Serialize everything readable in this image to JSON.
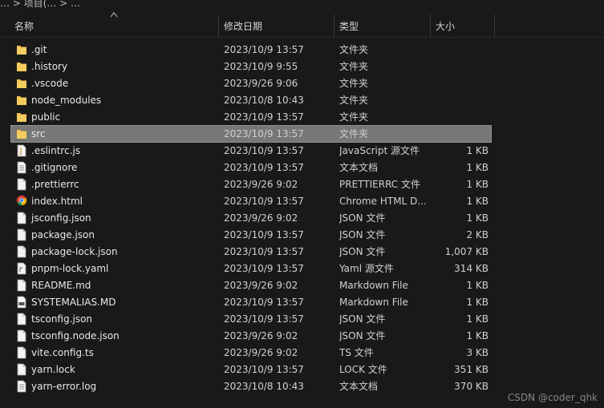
{
  "title_fragment": "… > 项目(… > …",
  "columns": {
    "name": "名称",
    "date": "修改日期",
    "type": "类型",
    "size": "大小"
  },
  "files": [
    {
      "name": ".git",
      "date": "2023/10/9 13:57",
      "type": "文件夹",
      "size": "",
      "icon": "folder-icon"
    },
    {
      "name": ".history",
      "date": "2023/10/9 9:55",
      "type": "文件夹",
      "size": "",
      "icon": "folder-icon"
    },
    {
      "name": ".vscode",
      "date": "2023/9/26 9:06",
      "type": "文件夹",
      "size": "",
      "icon": "folder-icon"
    },
    {
      "name": "node_modules",
      "date": "2023/10/8 10:43",
      "type": "文件夹",
      "size": "",
      "icon": "folder-icon"
    },
    {
      "name": "public",
      "date": "2023/10/9 13:57",
      "type": "文件夹",
      "size": "",
      "icon": "folder-icon"
    },
    {
      "name": "src",
      "date": "2023/10/9 13:57",
      "type": "文件夹",
      "size": "",
      "icon": "folder-icon",
      "selected": true
    },
    {
      "name": ".eslintrc.js",
      "date": "2023/10/9 13:57",
      "type": "JavaScript 源文件",
      "size": "1 KB",
      "icon": "js-file-icon"
    },
    {
      "name": ".gitignore",
      "date": "2023/10/9 13:57",
      "type": "文本文档",
      "size": "1 KB",
      "icon": "text-file-icon"
    },
    {
      "name": ".prettierrc",
      "date": "2023/9/26 9:02",
      "type": "PRETTIERRC 文件",
      "size": "1 KB",
      "icon": "file-icon"
    },
    {
      "name": "index.html",
      "date": "2023/10/9 13:57",
      "type": "Chrome HTML D...",
      "size": "1 KB",
      "icon": "chrome-icon"
    },
    {
      "name": "jsconfig.json",
      "date": "2023/9/26 9:02",
      "type": "JSON 文件",
      "size": "1 KB",
      "icon": "file-icon"
    },
    {
      "name": "package.json",
      "date": "2023/10/9 13:57",
      "type": "JSON 文件",
      "size": "2 KB",
      "icon": "file-icon"
    },
    {
      "name": "package-lock.json",
      "date": "2023/10/9 13:57",
      "type": "JSON 文件",
      "size": "1,007 KB",
      "icon": "file-icon"
    },
    {
      "name": "pnpm-lock.yaml",
      "date": "2023/10/9 13:57",
      "type": "Yaml 源文件",
      "size": "314 KB",
      "icon": "yaml-file-icon"
    },
    {
      "name": "README.md",
      "date": "2023/9/26 9:02",
      "type": "Markdown File",
      "size": "1 KB",
      "icon": "file-icon"
    },
    {
      "name": "SYSTEMALIAS.MD",
      "date": "2023/10/9 13:57",
      "type": "Markdown File",
      "size": "1 KB",
      "icon": "markdown-file-icon"
    },
    {
      "name": "tsconfig.json",
      "date": "2023/10/9 13:57",
      "type": "JSON 文件",
      "size": "1 KB",
      "icon": "file-icon"
    },
    {
      "name": "tsconfig.node.json",
      "date": "2023/9/26 9:02",
      "type": "JSON 文件",
      "size": "1 KB",
      "icon": "file-icon"
    },
    {
      "name": "vite.config.ts",
      "date": "2023/9/26 9:02",
      "type": "TS 文件",
      "size": "3 KB",
      "icon": "file-icon"
    },
    {
      "name": "yarn.lock",
      "date": "2023/10/9 13:57",
      "type": "LOCK 文件",
      "size": "351 KB",
      "icon": "file-icon"
    },
    {
      "name": "yarn-error.log",
      "date": "2023/10/8 10:43",
      "type": "文本文档",
      "size": "370 KB",
      "icon": "text-file-icon"
    }
  ],
  "watermark": "CSDN @coder_qhk",
  "colors": {
    "background": "#191919",
    "selected_row": "#777777",
    "folder": "#f2c14e"
  }
}
